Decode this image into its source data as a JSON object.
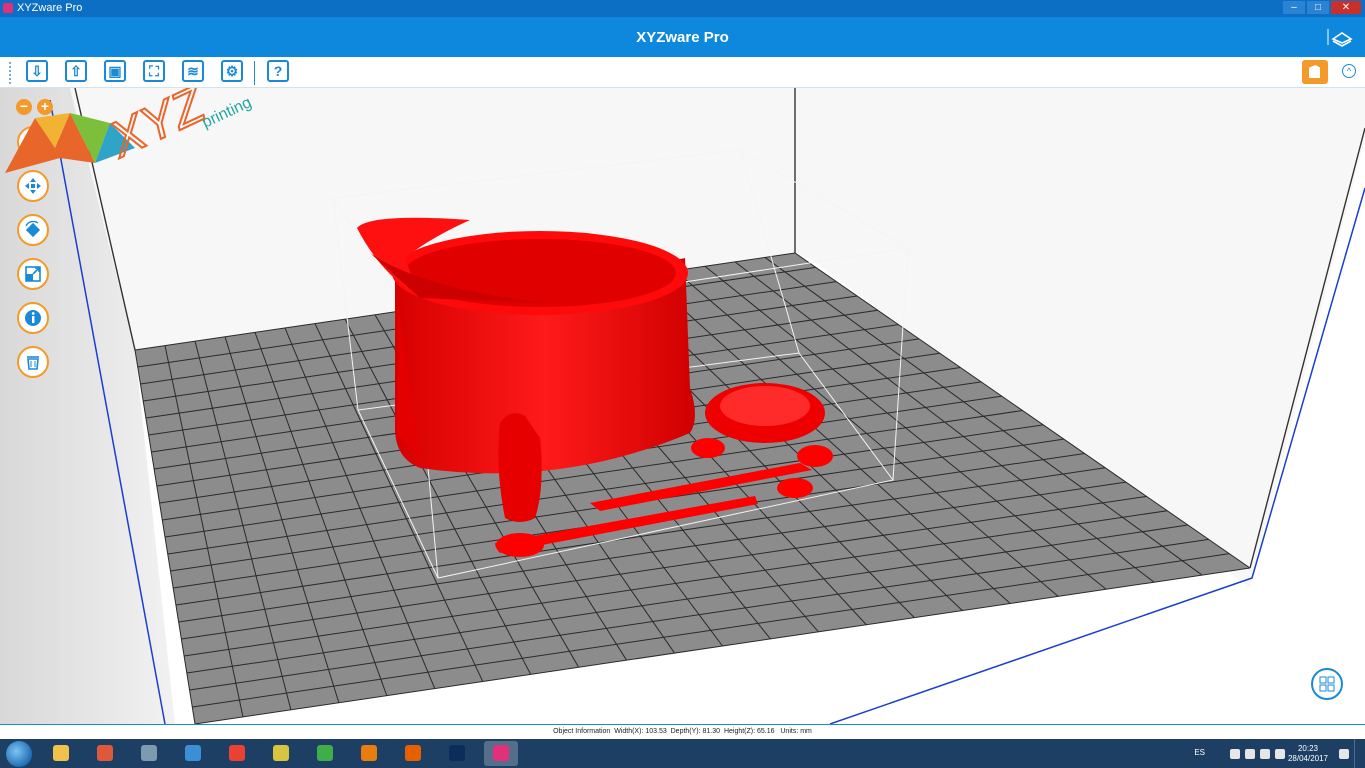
{
  "window": {
    "title": "XYZware Pro",
    "controls": [
      "–",
      "□",
      "✕"
    ]
  },
  "app": {
    "title": "XYZware Pro",
    "logo_icon": "xyz-logo-icon"
  },
  "toolbar": {
    "buttons": [
      {
        "name": "import",
        "icon": "import-arrow-icon",
        "glyph": "⇩"
      },
      {
        "name": "export",
        "icon": "export-arrow-icon",
        "glyph": "⇧"
      },
      {
        "name": "save",
        "icon": "save-icon",
        "glyph": "▣"
      },
      {
        "name": "print",
        "icon": "printer-icon",
        "glyph": "⛶"
      },
      {
        "name": "layers",
        "icon": "layers-icon",
        "glyph": "≋"
      },
      {
        "name": "settings",
        "icon": "gears-icon",
        "glyph": "⚙"
      },
      {
        "name": "help",
        "icon": "help-icon",
        "glyph": "?"
      }
    ],
    "machine_icon": "printer-status-icon",
    "collapse_glyph": "^"
  },
  "side_tools": {
    "zoom_out": "−",
    "zoom_in": "+",
    "tools": [
      "view-cube-icon",
      "move-icon",
      "rotate-icon",
      "scale-icon",
      "info-icon",
      "delete-icon"
    ]
  },
  "scene": {
    "object_color": "#ff0000",
    "bed_color": "#8c8c8c",
    "grid_line_color": "#2a2a2a",
    "bounds_color": "#1a3fd0"
  },
  "brand": {
    "text_xyz": "XYZ",
    "text_printing": "printing"
  },
  "status": {
    "label": "Object Information",
    "width": "Width(X): 103.53",
    "depth": "Depth(Y): 81.30",
    "height": "Height(Z): 65.16",
    "units": "Units: mm"
  },
  "taskbar": {
    "apps": [
      {
        "name": "explorer",
        "color": "#f0c24b"
      },
      {
        "name": "media",
        "color": "#e0583a"
      },
      {
        "name": "calculator",
        "color": "#7e9ab0"
      },
      {
        "name": "chrome-app",
        "color": "#3a8fd6"
      },
      {
        "name": "chrome",
        "color": "#e94235"
      },
      {
        "name": "pen-tool",
        "color": "#d7c540"
      },
      {
        "name": "corel",
        "color": "#3fae49"
      },
      {
        "name": "blender",
        "color": "#e87d0d"
      },
      {
        "name": "firefox",
        "color": "#e66000"
      },
      {
        "name": "photoshop",
        "color": "#0c2d5a"
      },
      {
        "name": "xyzware",
        "color": "#e2317a"
      }
    ],
    "language": "ES",
    "time": "20:23",
    "date": "28/04/2017"
  }
}
